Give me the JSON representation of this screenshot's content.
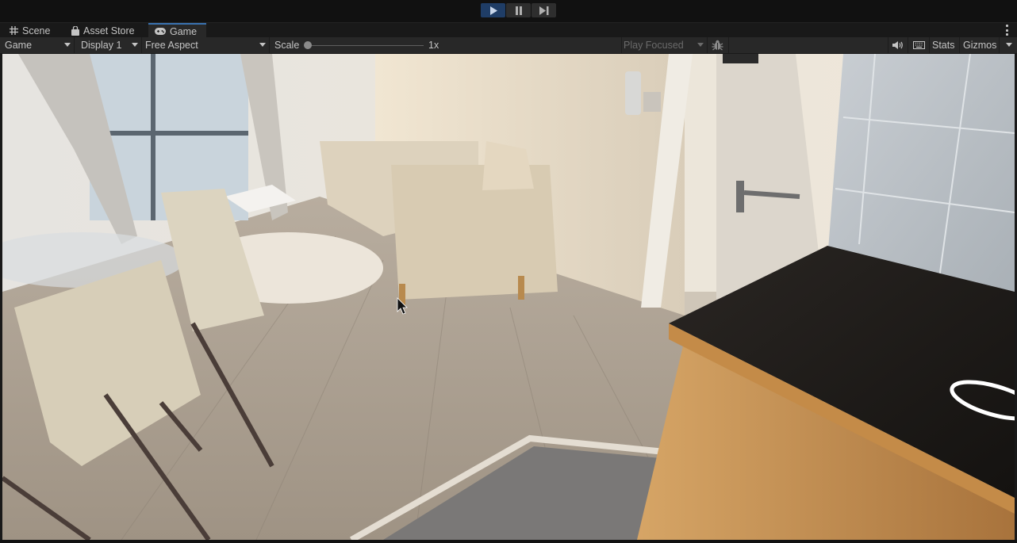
{
  "play_controls": {
    "play": {
      "icon": "play-icon",
      "active": true
    },
    "pause": {
      "icon": "pause-icon",
      "active": false
    },
    "step": {
      "icon": "step-icon",
      "active": false
    }
  },
  "tabs": [
    {
      "label": "Scene",
      "icon": "grid-icon",
      "active": false
    },
    {
      "label": "Asset Store",
      "icon": "shopping-bag-icon",
      "active": false
    },
    {
      "label": "Game",
      "icon": "gamepad-icon",
      "active": true
    }
  ],
  "toolbar": {
    "view_dropdown": "Game",
    "display_dropdown": "Display 1",
    "aspect_dropdown": "Free Aspect",
    "scale_label": "Scale",
    "scale_value": "1x",
    "scale_level": 0,
    "play_mode_dropdown": "Play Focused",
    "stats_label": "Stats",
    "gizmos_label": "Gizmos",
    "icons": {
      "bug": "bug-icon",
      "audio": "speaker-icon",
      "keyboard": "keyboard-icon",
      "more": "kebab-menu-icon"
    }
  },
  "game_view": {
    "description": "Rendered apartment interior: living room with beige sofa and armchair, dining chairs and glass table, fluffy rug, wooden floor, open door, black kitchen countertop with white ring marker",
    "colors": {
      "wall": "#e9e1d3",
      "floor": "#a99d8e",
      "countertop": "#1e1b18",
      "cabinet": "#c08a4c",
      "marker": "#ffffff"
    }
  }
}
